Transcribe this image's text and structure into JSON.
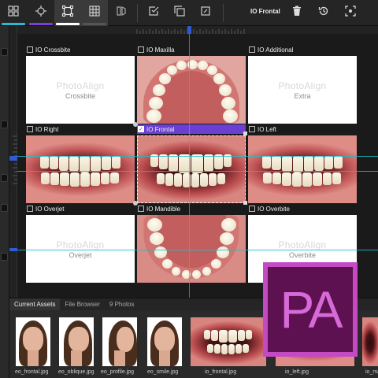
{
  "toolbar": {
    "title": "IO Frontal",
    "tools": [
      {
        "icon": "layout-grid-icon",
        "underline": "#2ab8d6"
      },
      {
        "icon": "crosshair-icon",
        "underline": "#7b3fd1"
      },
      {
        "icon": "bounding-box-icon",
        "underline": "#ffffff"
      },
      {
        "icon": "table-grid-icon",
        "underline": "#555555"
      },
      {
        "icon": "split-view-icon",
        "underline": ""
      }
    ],
    "actions": [
      "check-square-icon",
      "copy-icon",
      "crop-icon"
    ],
    "right_actions": [
      "trash-icon",
      "history-icon",
      "fullscreen-icon"
    ]
  },
  "slots": [
    {
      "label": "IO Crossbite",
      "checked": false,
      "type": "placeholder",
      "watermark": "PhotoAlign",
      "category": "Crossbite"
    },
    {
      "label": "IO Maxilla",
      "checked": false,
      "type": "photo",
      "view": "upper-arch"
    },
    {
      "label": "IO Additional",
      "checked": false,
      "type": "placeholder",
      "watermark": "PhotoAlign",
      "category": "Extra"
    },
    {
      "label": "IO Right",
      "checked": false,
      "type": "photo",
      "view": "right"
    },
    {
      "label": "IO Frontal",
      "checked": true,
      "selected": true,
      "type": "photo",
      "view": "frontal"
    },
    {
      "label": "IO Left",
      "checked": false,
      "type": "photo",
      "view": "left"
    },
    {
      "label": "IO Overjet",
      "checked": false,
      "type": "placeholder",
      "watermark": "PhotoAlign",
      "category": "Overjet"
    },
    {
      "label": "IO Mandible",
      "checked": false,
      "type": "photo",
      "view": "lower-arch"
    },
    {
      "label": "IO Overbite",
      "checked": false,
      "type": "placeholder",
      "watermark": "PhotoAlign",
      "category": "Overbite"
    }
  ],
  "assets": {
    "tabs": [
      "Current Assets",
      "File Browser",
      "9 Photos"
    ],
    "active_tab": 0,
    "items": [
      {
        "name": "eo_frontal.jpg"
      },
      {
        "name": "eo_oblique.jpg"
      },
      {
        "name": "eo_profile.jpg"
      },
      {
        "name": "eo_smile.jpg"
      },
      {
        "name": "io_frontal.jpg"
      },
      {
        "name": "io_left.jpg"
      },
      {
        "name": "io_ma"
      }
    ]
  },
  "logo": {
    "text": "PA"
  },
  "colors": {
    "accent": "#6a3fd1",
    "guide": "#19c0c7",
    "logo_bg": "#5e1150",
    "logo_fg": "#d66ad8"
  }
}
